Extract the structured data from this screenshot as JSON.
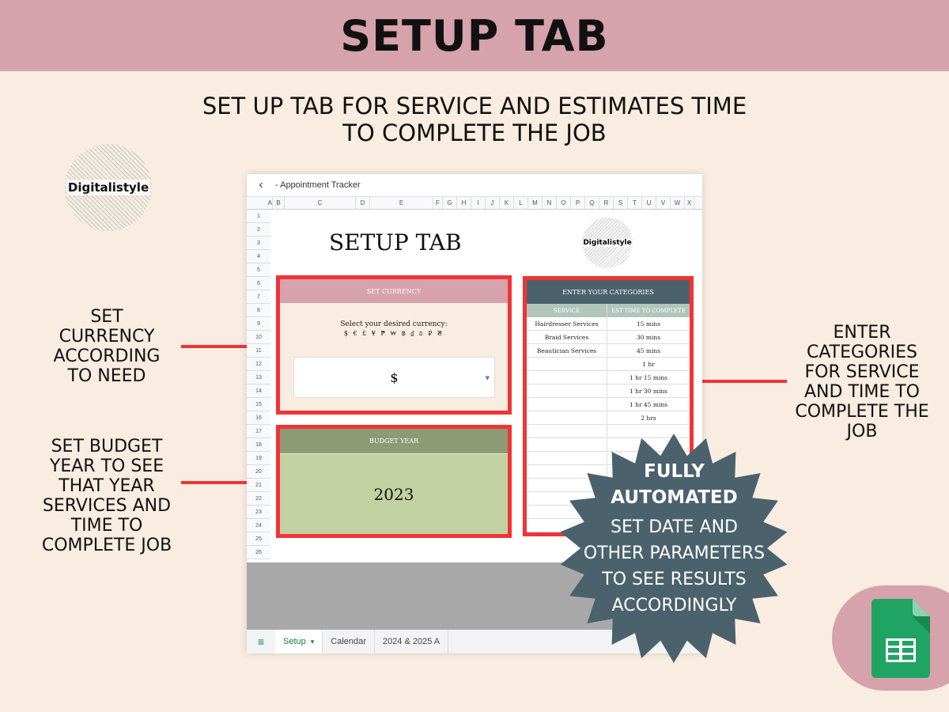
{
  "banner": {
    "title": "SETUP TAB"
  },
  "subtitle": {
    "line1": "SET UP TAB FOR SERVICE AND ESTIMATES TIME",
    "line2": "TO COMPLETE THE JOB"
  },
  "brand": {
    "logo_text": "Digitalistyle"
  },
  "annotations": {
    "currency": "SET CURRENCY ACCORDING TO NEED",
    "budget": "SET BUDGET YEAR TO SEE THAT YEAR SERVICES AND TIME TO COMPLETE JOB",
    "categories": "ENTER CATEGORIES FOR SERVICE AND TIME TO COMPLETE THE JOB"
  },
  "colors": {
    "banner": "#d6a2ab",
    "background": "#f9ece0",
    "highlight": "#f23337",
    "badge": "#4b626d",
    "sheets_green": "#1fa463"
  },
  "sheet": {
    "back_icon": "chevron-left-icon",
    "doc_title": "- Appointment Tracker",
    "columns": [
      "A",
      "B",
      "C",
      "D",
      "E",
      "F",
      "G",
      "H",
      "I",
      "J",
      "K",
      "L",
      "M",
      "N",
      "O",
      "P",
      "Q",
      "R",
      "S",
      "T",
      "U",
      "V",
      "W",
      "X"
    ],
    "rows": [
      "1",
      "2",
      "3",
      "4",
      "5",
      "6",
      "7",
      "8",
      "9",
      "10",
      "11",
      "12",
      "13",
      "14",
      "15",
      "16",
      "17",
      "18",
      "19",
      "20",
      "21",
      "22",
      "23",
      "24",
      "25",
      "26"
    ],
    "page_title": "SETUP TAB",
    "logo_text": "Digitalistyle",
    "currency": {
      "header": "SET CURRENCY",
      "prompt": "Select your desired currency:",
      "symbols": "$ € £ ¥ ₱ ₩ ฿ ₫ ₪ ₽ ₴",
      "selected": "$"
    },
    "budget": {
      "header": "BUDGET YEAR",
      "value": "2023"
    },
    "categories": {
      "header": "ENTER YOUR CATEGORIES",
      "col_service": "SERVICE",
      "col_time": "EST TIME TO COMPLETE",
      "rows": [
        {
          "service": "Hairdresser Services",
          "time": "15 mins"
        },
        {
          "service": "Braid Services",
          "time": "30 mins"
        },
        {
          "service": "Beautician Services",
          "time": "45 mins"
        },
        {
          "service": "",
          "time": "1 hr"
        },
        {
          "service": "",
          "time": "1 hr 15 mins"
        },
        {
          "service": "",
          "time": "1 hr 30 mins"
        },
        {
          "service": "",
          "time": "1 hr 45 mins"
        },
        {
          "service": "",
          "time": "2 hrs"
        },
        {
          "service": "",
          "time": ""
        },
        {
          "service": "",
          "time": ""
        },
        {
          "service": "",
          "time": ""
        },
        {
          "service": "",
          "time": ""
        },
        {
          "service": "",
          "time": ""
        },
        {
          "service": "",
          "time": ""
        },
        {
          "service": "",
          "time": ""
        },
        {
          "service": "",
          "time": ""
        },
        {
          "service": "",
          "time": ""
        }
      ]
    },
    "tabs": [
      {
        "label": "Setup",
        "active": true
      },
      {
        "label": "Calendar",
        "active": false
      },
      {
        "label": "2024 & 2025 A",
        "active": false
      }
    ]
  },
  "badge": {
    "line1": "FULLY",
    "line2": "AUTOMATED",
    "sub1": "SET DATE AND",
    "sub2": "OTHER PARAMETERS",
    "sub3": "TO SEE RESULTS",
    "sub4": "ACCORDINGLY"
  },
  "app_icon": "google-sheets-icon"
}
